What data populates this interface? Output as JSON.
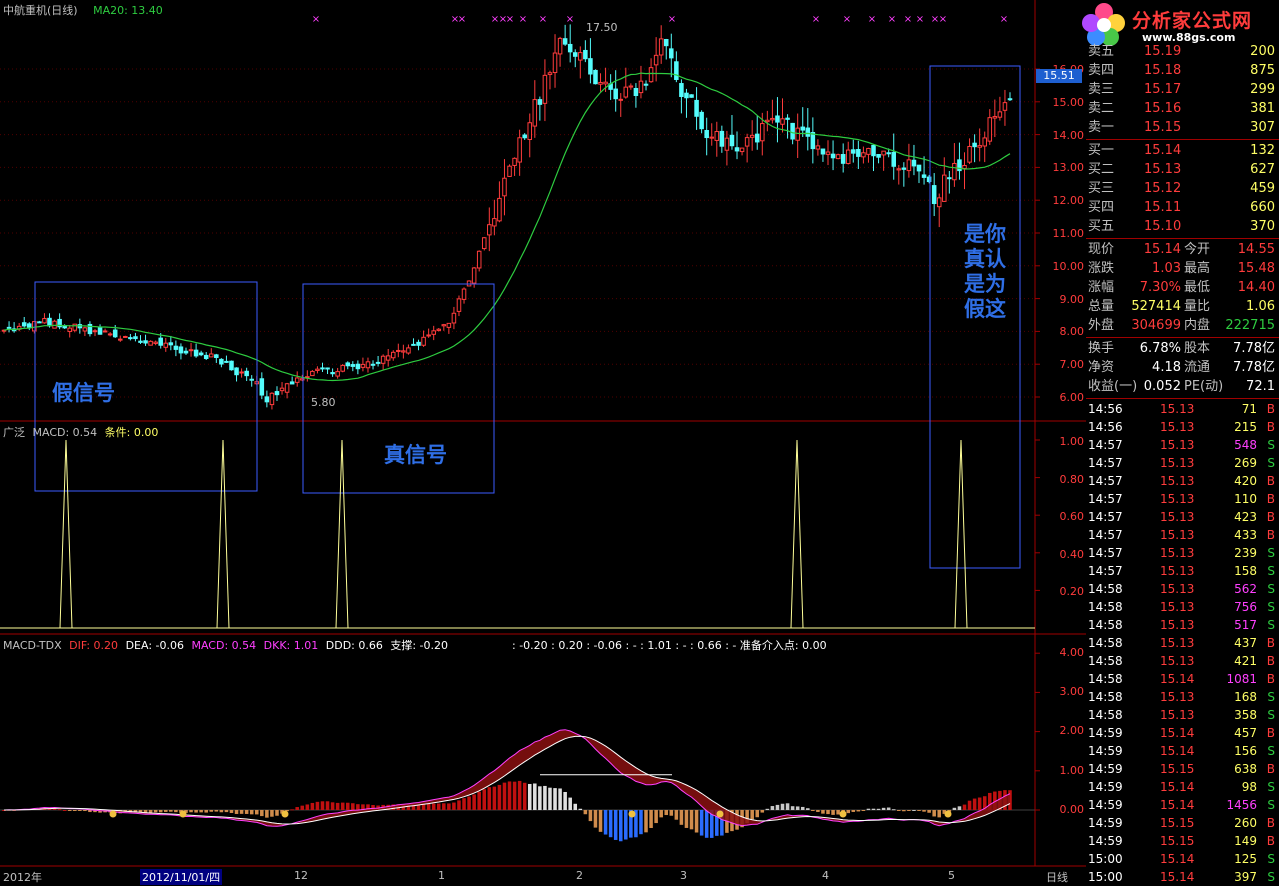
{
  "header": {
    "title": "中航重机(日线)",
    "ma_label": "MA20: 13.40"
  },
  "price_axis": {
    "ticks": [
      "16.00",
      "15.00",
      "14.00",
      "13.00",
      "12.00",
      "11.00",
      "10.00",
      "9.00",
      "8.00",
      "7.00",
      "6.00"
    ],
    "current_tag": "15.51"
  },
  "annotations": {
    "high_label": "17.50",
    "low_label": "5.80",
    "false_signal": "假信号",
    "true_signal": "真信号",
    "right_note_col1": "是你\n真认\n是为\n假这",
    "right_note_lines": [
      "是你",
      "真认",
      "是为",
      "假这"
    ]
  },
  "indicator1": {
    "label_prefix": "广泛",
    "label_macd": "MACD: 0.54",
    "label_cond": "条件: 0.00",
    "ticks": [
      "1.00",
      "0.80",
      "0.60",
      "0.40",
      "0.20"
    ]
  },
  "indicator2": {
    "name": "MACD-TDX",
    "dif": "DIF: 0.20",
    "dea": "DEA: -0.06",
    "macd": "MACD: 0.54",
    "dkk": "DKK: 1.01",
    "ddd": "DDD: 0.66",
    "support": "支撑: -0.20",
    "extra": ": -0.20  : 0.20  : -0.06  : -  : 1.01  : -  : 0.66  : -    准备介入点: 0.00",
    "ticks": [
      "4.00",
      "3.00",
      "2.00",
      "1.00",
      "0.00"
    ]
  },
  "x_axis": {
    "labels": [
      "2012年",
      "2012/11/01/四",
      "12",
      "1",
      "2",
      "3",
      "4",
      "5"
    ],
    "period_label": "日线"
  },
  "logo": {
    "brand": "分析家公式网",
    "url": "www.88gs.com"
  },
  "order_book": {
    "asks": [
      {
        "label": "卖五",
        "price": "15.19",
        "vol": "200"
      },
      {
        "label": "卖四",
        "price": "15.18",
        "vol": "875"
      },
      {
        "label": "卖三",
        "price": "15.17",
        "vol": "299"
      },
      {
        "label": "卖二",
        "price": "15.16",
        "vol": "381"
      },
      {
        "label": "卖一",
        "price": "15.15",
        "vol": "307"
      }
    ],
    "bids": [
      {
        "label": "买一",
        "price": "15.14",
        "vol": "132"
      },
      {
        "label": "买二",
        "price": "15.13",
        "vol": "627"
      },
      {
        "label": "买三",
        "price": "15.12",
        "vol": "459"
      },
      {
        "label": "买四",
        "price": "15.11",
        "vol": "660"
      },
      {
        "label": "买五",
        "price": "15.10",
        "vol": "370"
      }
    ]
  },
  "quote": [
    {
      "k1": "现价",
      "v1": "15.14",
      "k2": "今开",
      "v2": "14.55"
    },
    {
      "k1": "涨跌",
      "v1": "1.03",
      "k2": "最高",
      "v2": "15.48"
    },
    {
      "k1": "涨幅",
      "v1": "7.30%",
      "k2": "最低",
      "v2": "14.40"
    },
    {
      "k1": "总量",
      "v1": "527414",
      "k2": "量比",
      "v2": "1.06"
    },
    {
      "k1": "外盘",
      "v1": "304699",
      "k2": "内盘",
      "v2": "222715"
    }
  ],
  "fund": [
    {
      "k1": "换手",
      "v1": "6.78%",
      "k2": "股本",
      "v2": "7.78亿"
    },
    {
      "k1": "净资",
      "v1": "4.18",
      "k2": "流通",
      "v2": "7.78亿"
    },
    {
      "k1": "收益(一)",
      "v1": "0.052",
      "k2": "PE(动)",
      "v2": "72.1"
    }
  ],
  "ticks": [
    {
      "t": "14:56",
      "p": "15.13",
      "v": "71",
      "s": "B"
    },
    {
      "t": "14:56",
      "p": "15.13",
      "v": "215",
      "s": "B"
    },
    {
      "t": "14:57",
      "p": "15.13",
      "v": "548",
      "s": "S"
    },
    {
      "t": "14:57",
      "p": "15.13",
      "v": "269",
      "s": "S"
    },
    {
      "t": "14:57",
      "p": "15.13",
      "v": "420",
      "s": "B"
    },
    {
      "t": "14:57",
      "p": "15.13",
      "v": "110",
      "s": "B"
    },
    {
      "t": "14:57",
      "p": "15.13",
      "v": "423",
      "s": "B"
    },
    {
      "t": "14:57",
      "p": "15.13",
      "v": "433",
      "s": "B"
    },
    {
      "t": "14:57",
      "p": "15.13",
      "v": "239",
      "s": "S"
    },
    {
      "t": "14:57",
      "p": "15.13",
      "v": "158",
      "s": "S"
    },
    {
      "t": "14:58",
      "p": "15.13",
      "v": "562",
      "s": "S"
    },
    {
      "t": "14:58",
      "p": "15.13",
      "v": "756",
      "s": "S"
    },
    {
      "t": "14:58",
      "p": "15.13",
      "v": "517",
      "s": "S"
    },
    {
      "t": "14:58",
      "p": "15.13",
      "v": "437",
      "s": "B"
    },
    {
      "t": "14:58",
      "p": "15.13",
      "v": "421",
      "s": "B"
    },
    {
      "t": "14:58",
      "p": "15.14",
      "v": "1081",
      "s": "B"
    },
    {
      "t": "14:58",
      "p": "15.13",
      "v": "168",
      "s": "S"
    },
    {
      "t": "14:58",
      "p": "15.13",
      "v": "358",
      "s": "S"
    },
    {
      "t": "14:59",
      "p": "15.14",
      "v": "457",
      "s": "B"
    },
    {
      "t": "14:59",
      "p": "15.14",
      "v": "156",
      "s": "S"
    },
    {
      "t": "14:59",
      "p": "15.15",
      "v": "638",
      "s": "B"
    },
    {
      "t": "14:59",
      "p": "15.14",
      "v": "98",
      "s": "S"
    },
    {
      "t": "14:59",
      "p": "15.14",
      "v": "1456",
      "s": "S"
    },
    {
      "t": "14:59",
      "p": "15.15",
      "v": "260",
      "s": "B"
    },
    {
      "t": "14:59",
      "p": "15.15",
      "v": "149",
      "s": "B"
    },
    {
      "t": "15:00",
      "p": "15.14",
      "v": "125",
      "s": "S"
    },
    {
      "t": "15:00",
      "p": "15.14",
      "v": "397",
      "s": "S"
    }
  ],
  "colors": {
    "up": "#ff3c3c",
    "down": "#54fcfc",
    "ma": "#2ecc40",
    "grid": "#a00000",
    "axis": "#c0c0c0",
    "box": "#3c5cff",
    "signal": "#ffff99",
    "purple": "#ff40ff"
  }
}
